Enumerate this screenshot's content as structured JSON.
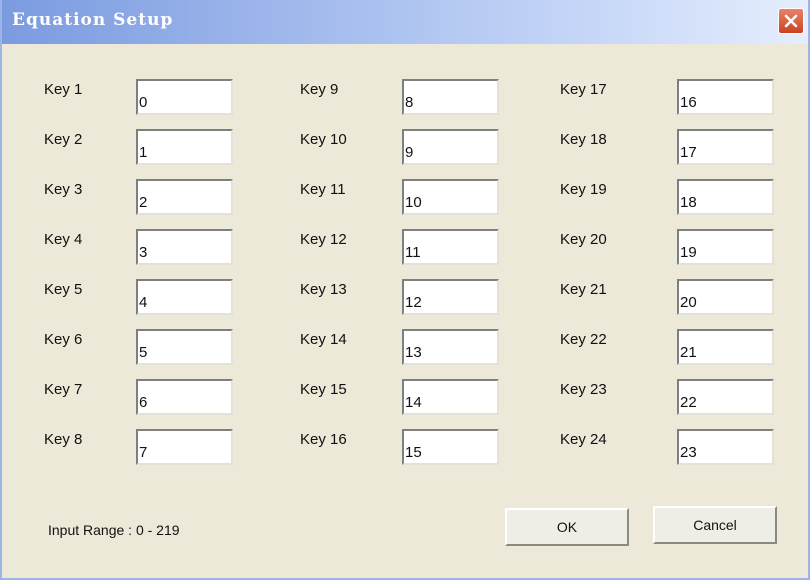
{
  "dialog": {
    "title": "Equation Setup",
    "close_icon": "close-icon"
  },
  "keys": [
    {
      "label": "Key 1",
      "value": "0"
    },
    {
      "label": "Key 2",
      "value": "1"
    },
    {
      "label": "Key 3",
      "value": "2"
    },
    {
      "label": "Key 4",
      "value": "3"
    },
    {
      "label": "Key 5",
      "value": "4"
    },
    {
      "label": "Key 6",
      "value": "5"
    },
    {
      "label": "Key 7",
      "value": "6"
    },
    {
      "label": "Key 8",
      "value": "7"
    },
    {
      "label": "Key 9",
      "value": "8"
    },
    {
      "label": "Key 10",
      "value": "9"
    },
    {
      "label": "Key 11",
      "value": "10"
    },
    {
      "label": "Key 12",
      "value": "11"
    },
    {
      "label": "Key 13",
      "value": "12"
    },
    {
      "label": "Key 14",
      "value": "13"
    },
    {
      "label": "Key 15",
      "value": "14"
    },
    {
      "label": "Key 16",
      "value": "15"
    },
    {
      "label": "Key 17",
      "value": "16"
    },
    {
      "label": "Key 18",
      "value": "17"
    },
    {
      "label": "Key 19",
      "value": "18"
    },
    {
      "label": "Key 20",
      "value": "19"
    },
    {
      "label": "Key 21",
      "value": "20"
    },
    {
      "label": "Key 22",
      "value": "21"
    },
    {
      "label": "Key 23",
      "value": "22"
    },
    {
      "label": "Key 24",
      "value": "23"
    }
  ],
  "footer": {
    "range_text": "Input Range : 0 - 219",
    "ok_label": "OK",
    "cancel_label": "Cancel"
  },
  "colors": {
    "title_text": "#ffffff",
    "close_button": "#d2532f",
    "dialog_bg": "#ece9d8"
  }
}
